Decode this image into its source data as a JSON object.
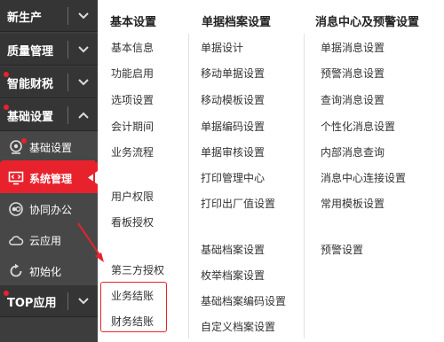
{
  "sidebar": {
    "items": [
      {
        "label": "新生产"
      },
      {
        "label": "质量管理"
      },
      {
        "label": "智能财税"
      },
      {
        "label": "基础设置"
      },
      {
        "label": "TOP应用"
      }
    ],
    "sub_items": [
      {
        "label": "基础设置",
        "icon": "webcam-icon"
      },
      {
        "label": "系统管理",
        "icon": "monitor-code-icon"
      },
      {
        "label": "协同办公",
        "icon": "collaboration-icon"
      },
      {
        "label": "云应用",
        "icon": "cloud-icon"
      },
      {
        "label": "初始化",
        "icon": "refresh-icon"
      }
    ]
  },
  "columns": [
    {
      "header": "基本设置",
      "links": [
        "基本信息",
        "功能启用",
        "选项设置",
        "会计期间",
        "业务流程",
        "用户权限",
        "看板授权",
        "第三方授权",
        "业务结账",
        "财务结账"
      ]
    },
    {
      "header": "单据档案设置",
      "links": [
        "单据设计",
        "移动单据设置",
        "移动模板设置",
        "单据编码设置",
        "单据审核设置",
        "打印管理中心",
        "打印出厂值设置",
        "基础档案设置",
        "枚举档案设置",
        "基础档案编码设置",
        "自定义档案设置"
      ]
    },
    {
      "header": "消息中心及预警设置",
      "links": [
        "单据消息设置",
        "预警消息设置",
        "查询消息设置",
        "个性化消息设置",
        "内部消息查询",
        "消息中心连接设置",
        "常用模板设置",
        "预警设置"
      ]
    }
  ],
  "colors": {
    "accent": "#e8222c",
    "sidebar_bg": "#3d3d3d",
    "sub_bg": "#474747"
  }
}
